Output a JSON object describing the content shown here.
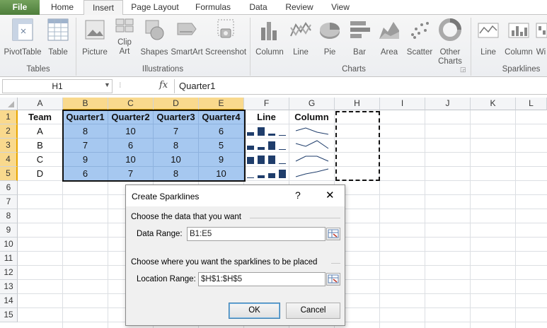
{
  "tabs": [
    "File",
    "Home",
    "Insert",
    "Page Layout",
    "Formulas",
    "Data",
    "Review",
    "View"
  ],
  "active_tab": "Insert",
  "ribbon": {
    "groups": [
      {
        "label": "Tables",
        "buttons": [
          {
            "label": "PivotTable",
            "icon": "pivottable-icon"
          },
          {
            "label": "Table",
            "icon": "table-icon"
          }
        ]
      },
      {
        "label": "Illustrations",
        "buttons": [
          {
            "label": "Picture",
            "icon": "picture-icon"
          },
          {
            "label": "Clip Art",
            "icon": "clipart-icon"
          },
          {
            "label": "Shapes",
            "icon": "shapes-icon"
          },
          {
            "label": "SmartArt",
            "icon": "smartart-icon"
          },
          {
            "label": "Screenshot",
            "icon": "screenshot-icon"
          }
        ]
      },
      {
        "label": "Charts",
        "buttons": [
          {
            "label": "Column",
            "icon": "column-chart-icon"
          },
          {
            "label": "Line",
            "icon": "line-chart-icon"
          },
          {
            "label": "Pie",
            "icon": "pie-chart-icon"
          },
          {
            "label": "Bar",
            "icon": "bar-chart-icon"
          },
          {
            "label": "Area",
            "icon": "area-chart-icon"
          },
          {
            "label": "Scatter",
            "icon": "scatter-chart-icon"
          },
          {
            "label": "Other Charts",
            "icon": "other-charts-icon"
          }
        ]
      },
      {
        "label": "Sparklines",
        "buttons": [
          {
            "label": "Line",
            "icon": "sparkline-line-icon"
          },
          {
            "label": "Column",
            "icon": "sparkline-column-icon"
          },
          {
            "label": "Wi",
            "icon": "sparkline-winloss-icon"
          }
        ]
      }
    ]
  },
  "formula_bar": {
    "name_box": "H1",
    "fx": "fx",
    "content": "Quarter1"
  },
  "columns": [
    "A",
    "B",
    "C",
    "D",
    "E",
    "F",
    "G",
    "H",
    "I",
    "J",
    "K",
    "L"
  ],
  "rows": [
    "1",
    "2",
    "3",
    "4",
    "5",
    "6",
    "7",
    "8",
    "9",
    "10",
    "11",
    "12",
    "13",
    "14",
    "15"
  ],
  "table": {
    "headers": [
      "Team",
      "Quarter1",
      "Quarter2",
      "Quarter3",
      "Quarter4",
      "Line",
      "Column"
    ],
    "rows": [
      [
        "A",
        "8",
        "10",
        "7",
        "6"
      ],
      [
        "B",
        "7",
        "6",
        "8",
        "5"
      ],
      [
        "C",
        "9",
        "10",
        "10",
        "9"
      ],
      [
        "D",
        "6",
        "7",
        "8",
        "10"
      ]
    ]
  },
  "dialog": {
    "title": "Create Sparklines",
    "help": "?",
    "close": "✕",
    "section1": "Choose the data that you want",
    "data_range_label": "Data Range:",
    "data_range_value": "B1:E5",
    "section2": "Choose where you want the sparklines to be placed",
    "location_range_label": "Location Range:",
    "location_range_value": "$H$1:$H$5",
    "ok": "OK",
    "cancel": "Cancel"
  },
  "colors": {
    "file_tab": "#5a8a45",
    "selection": "#a6c8f0",
    "header_highlight": "#f9d98d",
    "sparkline": "#1f3d6b"
  }
}
